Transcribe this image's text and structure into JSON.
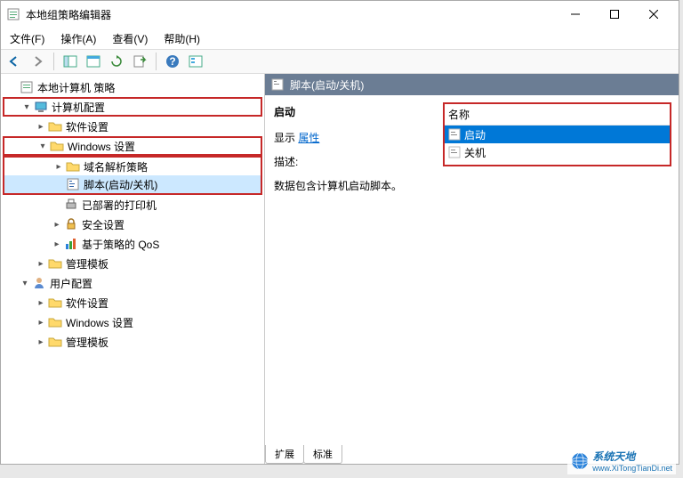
{
  "window": {
    "title": "本地组策略编辑器"
  },
  "menu": {
    "file": "文件(F)",
    "action": "操作(A)",
    "view": "查看(V)",
    "help": "帮助(H)"
  },
  "tree": {
    "root": "本地计算机 策略",
    "computer_config": "计算机配置",
    "software_settings1": "软件设置",
    "windows_settings1": "Windows 设置",
    "name_res_policy": "域名解析策略",
    "scripts": "脚本(启动/关机)",
    "deployed_printers": "已部署的打印机",
    "security_settings": "安全设置",
    "policy_qos": "基于策略的 QoS",
    "admin_templates1": "管理模板",
    "user_config": "用户配置",
    "software_settings2": "软件设置",
    "windows_settings2": "Windows 设置",
    "admin_templates2": "管理模板"
  },
  "detail": {
    "header": "脚本(启动/关机)",
    "heading": "启动",
    "show_prefix": "显示 ",
    "properties_link": "属性",
    "desc_label": "描述:",
    "desc_text": "数据包含计算机启动脚本。",
    "col_name": "名称",
    "item_startup": "启动",
    "item_shutdown": "关机"
  },
  "tabs": {
    "extended": "扩展",
    "standard": "标准"
  },
  "watermark": {
    "brand": "系统天地",
    "url": "www.XiTongTianDi.net"
  }
}
